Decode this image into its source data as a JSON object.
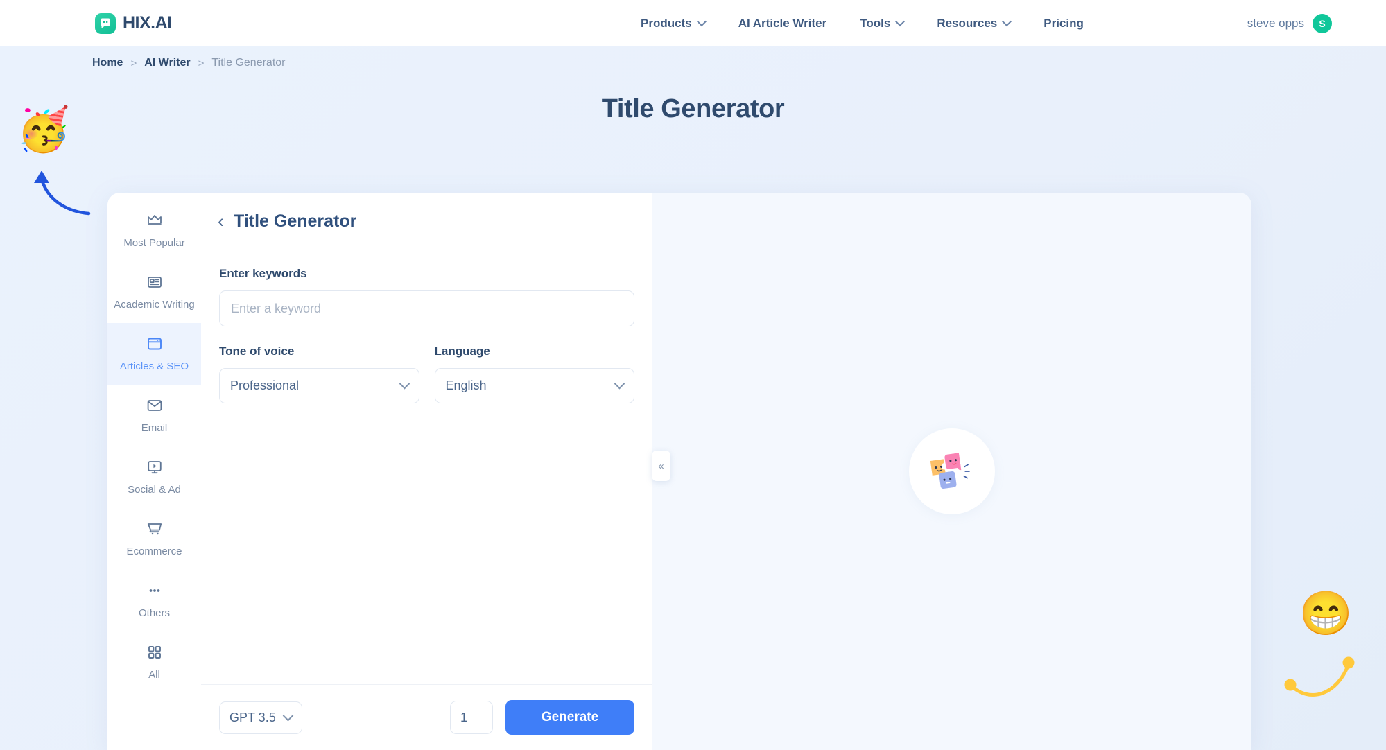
{
  "brand": {
    "name": "HIX.AI",
    "logo_icon": "chat-bubble-icon"
  },
  "nav": {
    "items": [
      {
        "label": "Products",
        "has_dropdown": true
      },
      {
        "label": "AI Article Writer",
        "has_dropdown": false
      },
      {
        "label": "Tools",
        "has_dropdown": true
      },
      {
        "label": "Resources",
        "has_dropdown": true
      },
      {
        "label": "Pricing",
        "has_dropdown": false
      }
    ],
    "user": {
      "name": "steve opps",
      "avatar_initial": "S",
      "avatar_color": "#10c79a"
    }
  },
  "breadcrumb": {
    "home": "Home",
    "sep1": ">",
    "section": "AI Writer",
    "sep2": ">",
    "current": "Title Generator"
  },
  "page": {
    "title": "Title Generator"
  },
  "sidebar": {
    "items": [
      {
        "label": "Most Popular",
        "icon": "crown-icon",
        "active": false
      },
      {
        "label": "Academic Writing",
        "icon": "article-card-icon",
        "active": false
      },
      {
        "label": "Articles & SEO",
        "icon": "browser-window-icon",
        "active": true
      },
      {
        "label": "Email",
        "icon": "envelope-icon",
        "active": false
      },
      {
        "label": "Social & Ad",
        "icon": "monitor-play-icon",
        "active": false
      },
      {
        "label": "Ecommerce",
        "icon": "shopping-cart-icon",
        "active": false
      },
      {
        "label": "Others",
        "icon": "ellipsis-icon",
        "active": false
      },
      {
        "label": "All",
        "icon": "grid-four-icon",
        "active": false
      }
    ]
  },
  "form": {
    "back_icon": "chevron-left-icon",
    "title": "Title Generator",
    "keywords": {
      "label": "Enter keywords",
      "value": "",
      "placeholder": "Enter a keyword"
    },
    "tone": {
      "label": "Tone of voice",
      "value": "Professional"
    },
    "language": {
      "label": "Language",
      "value": "English"
    },
    "footer": {
      "model": "GPT 3.5",
      "quantity": "1",
      "generate_label": "Generate"
    }
  },
  "result": {
    "collapse_icon": "double-chevron-left-icon",
    "collapse_label": "«",
    "empty_illustration": "puzzle-pieces-icon"
  },
  "decorations": {
    "party_emoji": "🥳",
    "grin_emoji": "😁",
    "arrow_color": "#2255dd",
    "curve_color": "#ffc93c"
  },
  "colors": {
    "accent_blue": "#3f7ef8",
    "brand_teal": "#10c79a",
    "text_dark": "#2f4a6d",
    "page_bg": "#eaf1fb"
  }
}
